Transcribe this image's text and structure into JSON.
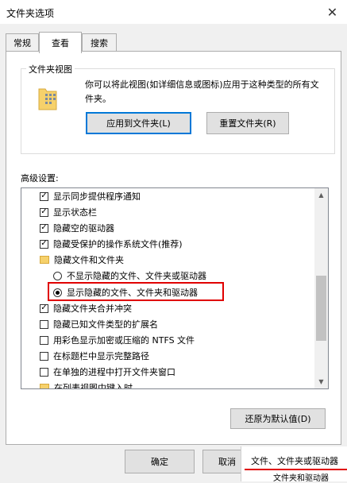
{
  "window": {
    "title": "文件夹选项",
    "close_glyph": "✕"
  },
  "tabs": [
    {
      "label": "常规",
      "active": false
    },
    {
      "label": "查看",
      "active": true
    },
    {
      "label": "搜索",
      "active": false
    }
  ],
  "folder_view": {
    "title": "文件夹视图",
    "description": "你可以将此视图(如详细信息或图标)应用于这种类型的所有文件夹。",
    "apply_label": "应用到文件夹(L)",
    "reset_label": "重置文件夹(R)"
  },
  "advanced": {
    "label": "高级设置:",
    "items": [
      {
        "type": "checkbox",
        "checked": true,
        "indent": 0,
        "label": "显示同步提供程序通知"
      },
      {
        "type": "checkbox",
        "checked": true,
        "indent": 0,
        "label": "显示状态栏"
      },
      {
        "type": "checkbox",
        "checked": true,
        "indent": 0,
        "label": "隐藏空的驱动器"
      },
      {
        "type": "checkbox",
        "checked": true,
        "indent": 0,
        "label": "隐藏受保护的操作系统文件(推荐)"
      },
      {
        "type": "folder",
        "indent": 0,
        "label": "隐藏文件和文件夹"
      },
      {
        "type": "radio",
        "checked": false,
        "indent": 1,
        "label": "不显示隐藏的文件、文件夹或驱动器"
      },
      {
        "type": "radio",
        "checked": true,
        "indent": 1,
        "label": "显示隐藏的文件、文件夹和驱动器"
      },
      {
        "type": "checkbox",
        "checked": true,
        "indent": 0,
        "label": "隐藏文件夹合并冲突"
      },
      {
        "type": "checkbox",
        "checked": false,
        "indent": 0,
        "label": "隐藏已知文件类型的扩展名"
      },
      {
        "type": "checkbox",
        "checked": false,
        "indent": 0,
        "label": "用彩色显示加密或压缩的 NTFS 文件"
      },
      {
        "type": "checkbox",
        "checked": false,
        "indent": 0,
        "label": "在标题栏中显示完整路径"
      },
      {
        "type": "checkbox",
        "checked": false,
        "indent": 0,
        "label": "在单独的进程中打开文件夹窗口"
      },
      {
        "type": "folder",
        "indent": 0,
        "label": "在列表视图中键入时"
      }
    ],
    "restore_label": "还原为默认值(D)"
  },
  "footer": {
    "ok_label": "确定",
    "cancel_label": "取消",
    "overlay_text_1": "文件、文件夹或驱动器",
    "overlay_text_2": "文件夹和驱动器"
  },
  "colors": {
    "accent": "#0078d7",
    "highlight": "#e00000",
    "folder": "#f6d16b"
  }
}
